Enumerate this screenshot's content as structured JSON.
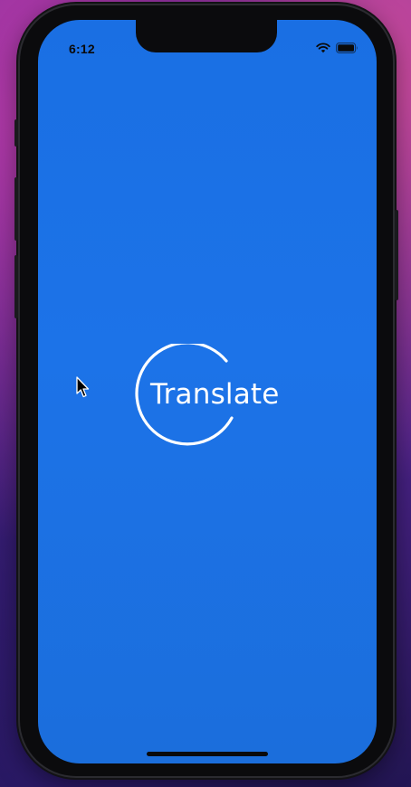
{
  "status_bar": {
    "time": "6:12",
    "icons": [
      "wifi-icon",
      "battery-icon"
    ]
  },
  "splash": {
    "logo_text": "Translate"
  },
  "colors": {
    "screen_background": "#1c73e8",
    "logo": "#ffffff",
    "status_text": "#0a0a0a"
  },
  "icons": [
    "wifi-icon",
    "battery-icon",
    "logo-ring-icon",
    "mouse-pointer-icon"
  ]
}
